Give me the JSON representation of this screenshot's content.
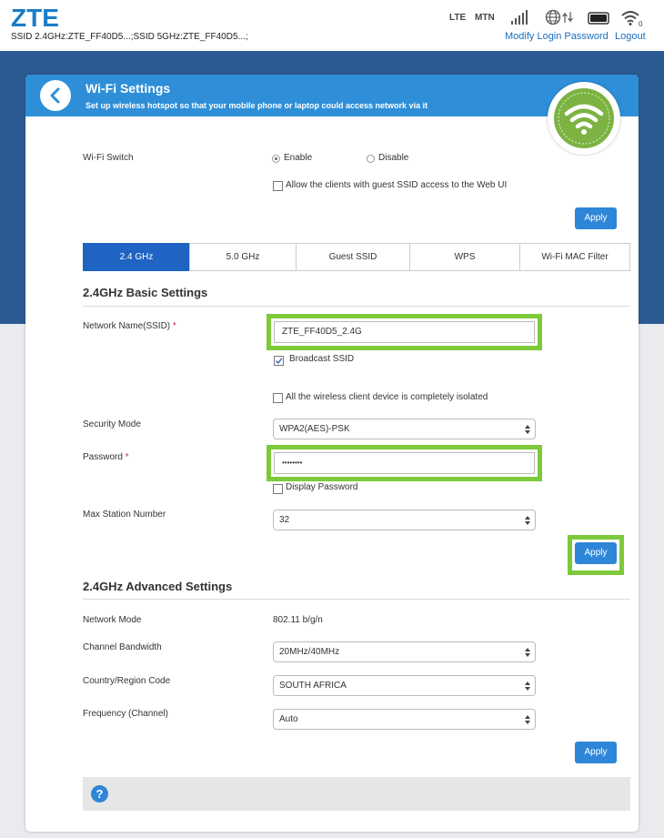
{
  "top": {
    "logo": "ZTE",
    "ssid_line": "SSID 2.4GHz:ZTE_FF40D5...;SSID 5GHz:ZTE_FF40D5...;",
    "network_type": "LTE",
    "operator": "MTN",
    "modify_password": "Modify Login Password",
    "logout": "Logout"
  },
  "header": {
    "title": "Wi-Fi Settings",
    "subtitle": "Set up wireless hotspot so that your mobile phone or laptop could access network via it"
  },
  "wifi_switch": {
    "label": "Wi-Fi Switch",
    "enable": "Enable",
    "disable": "Disable",
    "selected": "Enable",
    "guest_access": "Allow the clients with guest SSID access to the Web UI",
    "apply": "Apply"
  },
  "tabs": [
    {
      "label": "2.4 GHz",
      "active": true
    },
    {
      "label": "5.0 GHz",
      "active": false
    },
    {
      "label": "Guest SSID",
      "active": false
    },
    {
      "label": "WPS",
      "active": false
    },
    {
      "label": "Wi-Fi MAC Filter",
      "active": false
    }
  ],
  "basic": {
    "title": "2.4GHz Basic Settings",
    "ssid_label": "Network Name(SSID)",
    "required_mark": "*",
    "ssid_value": "ZTE_FF40D5_2.4G",
    "broadcast_label": "Broadcast SSID",
    "broadcast_checked": true,
    "isolated_label": "All the wireless client device is completely isolated",
    "security_label": "Security Mode",
    "security_value": "WPA2(AES)-PSK",
    "password_label": "Password",
    "password_value": "••••••••",
    "display_password": "Display Password",
    "max_station_label": "Max Station Number",
    "max_station_value": "32",
    "apply": "Apply"
  },
  "advanced": {
    "title": "2.4GHz Advanced Settings",
    "mode_label": "Network Mode",
    "mode_value": "802.11 b/g/n",
    "bandwidth_label": "Channel Bandwidth",
    "bandwidth_value": "20MHz/40MHz",
    "country_label": "Country/Region Code",
    "country_value": "SOUTH AFRICA",
    "frequency_label": "Frequency (Channel)",
    "frequency_value": "Auto",
    "apply": "Apply"
  },
  "help": {
    "icon": "?"
  },
  "colors": {
    "header_blue": "#2e8fd8",
    "active_tab": "#1f63c3",
    "highlight_green": "#7cc93a",
    "wifi_green": "#7cb342",
    "page_blue": "#2c5a93"
  }
}
